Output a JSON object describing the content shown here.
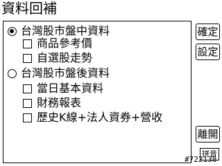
{
  "title": "資料回補",
  "options": [
    {
      "label": "台灣股市盤中資料",
      "selected": true,
      "children": [
        {
          "label": "商品參考價",
          "checked": false
        },
        {
          "label": "自選股走勢",
          "checked": false
        }
      ]
    },
    {
      "label": "台灣股市盤後資料",
      "selected": false,
      "children": [
        {
          "label": "當日基本資料",
          "checked": false
        },
        {
          "label": "財務報表",
          "checked": false
        },
        {
          "label": "歷史K線+法人資券+營收",
          "checked": false
        }
      ]
    }
  ],
  "buttons": {
    "confirm": "確定",
    "settings": "設定",
    "exit": "離開"
  },
  "ime_label": "拼音",
  "watermark": "#722138"
}
